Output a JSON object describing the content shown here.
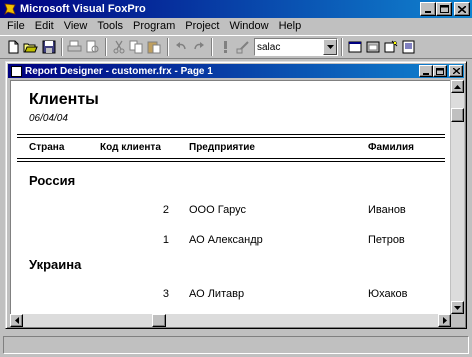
{
  "app": {
    "title": "Microsoft Visual FoxPro",
    "icons": [
      "foxpro-icon"
    ]
  },
  "menu": [
    "File",
    "Edit",
    "View",
    "Tools",
    "Program",
    "Project",
    "Window",
    "Help"
  ],
  "toolbar": {
    "combo_value": "salac"
  },
  "child_window": {
    "title": "Report Designer - customer.frx - Page 1"
  },
  "report": {
    "title": "Клиенты",
    "date": "06/04/04",
    "columns": [
      "Страна",
      "Код клиента",
      "Предприятие",
      "Фамилия"
    ],
    "groups": [
      {
        "name": "Россия",
        "rows": [
          {
            "code": "2",
            "company": "ООО Гарус",
            "surname": "Иванов"
          },
          {
            "code": "1",
            "company": "АО Александр",
            "surname": "Петров"
          }
        ]
      },
      {
        "name": "Украина",
        "rows": [
          {
            "code": "3",
            "company": "АО Литавр",
            "surname": "Юхаков"
          }
        ]
      }
    ]
  },
  "colors": {
    "titlebar": "#000080",
    "face": "#c0c0c0"
  }
}
